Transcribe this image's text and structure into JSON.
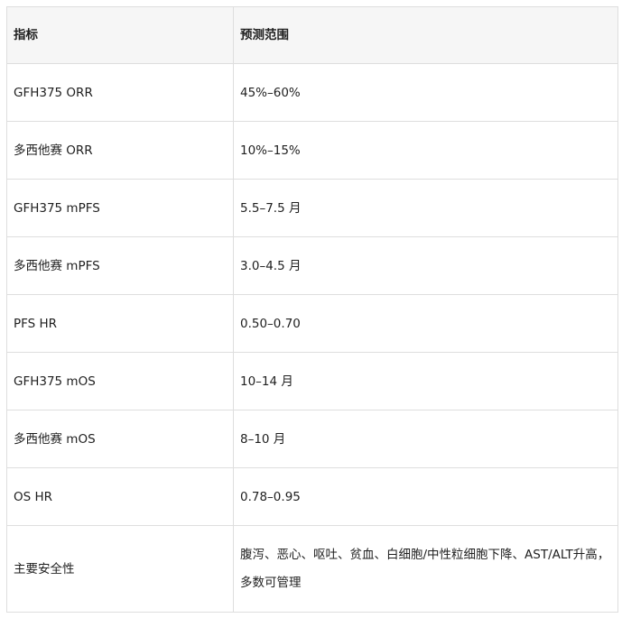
{
  "table": {
    "headers": [
      "指标",
      "预测范围"
    ],
    "rows": [
      [
        "GFH375 ORR",
        "45%–60%"
      ],
      [
        "多西他赛 ORR",
        "10%–15%"
      ],
      [
        "GFH375 mPFS",
        "5.5–7.5 月"
      ],
      [
        "多西他赛 mPFS",
        "3.0–4.5 月"
      ],
      [
        "PFS HR",
        "0.50–0.70"
      ],
      [
        "GFH375 mOS",
        "10–14 月"
      ],
      [
        "多西他赛 mOS",
        "8–10 月"
      ],
      [
        "OS HR",
        "0.78–0.95"
      ],
      [
        "主要安全性",
        "腹泻、恶心、呕吐、贫血、白细胞/中性粒细胞下降、AST/ALT升高，多数可管理"
      ]
    ]
  }
}
